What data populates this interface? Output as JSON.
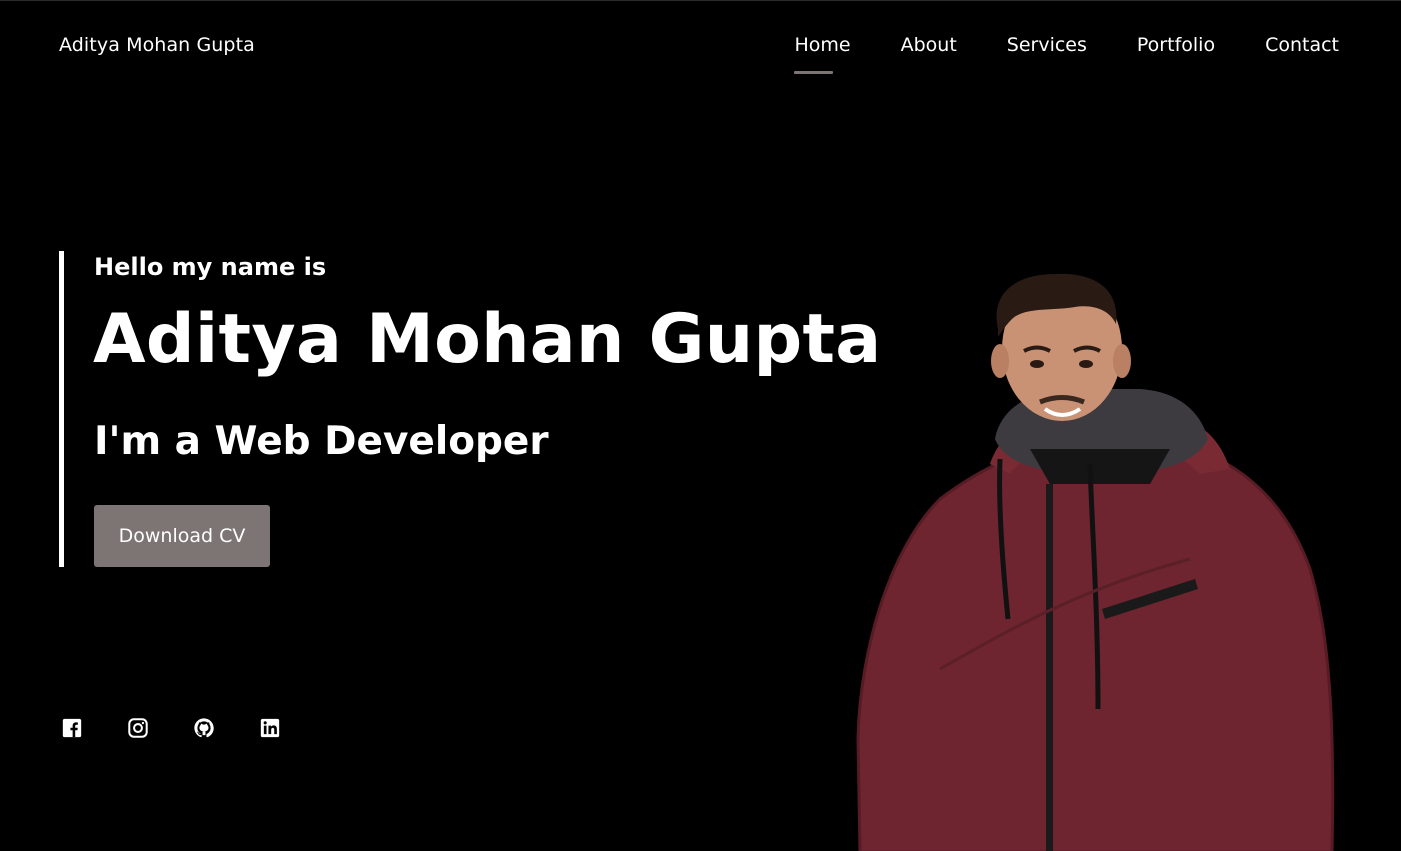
{
  "header": {
    "brand": "Aditya Mohan Gupta",
    "nav": [
      {
        "label": "Home",
        "active": true
      },
      {
        "label": "About",
        "active": false
      },
      {
        "label": "Services",
        "active": false
      },
      {
        "label": "Portfolio",
        "active": false
      },
      {
        "label": "Contact",
        "active": false
      }
    ]
  },
  "hero": {
    "greeting": "Hello my name is",
    "name": "Aditya Mohan Gupta",
    "role": "I'm a Web Developer",
    "cv_button": "Download CV"
  },
  "social": [
    {
      "icon": "facebook-icon"
    },
    {
      "icon": "instagram-icon"
    },
    {
      "icon": "github-icon"
    },
    {
      "icon": "linkedin-icon"
    }
  ],
  "colors": {
    "background": "#000000",
    "text": "#ffffff",
    "accent": "#7d7474",
    "jacket": "#7a2a33"
  }
}
